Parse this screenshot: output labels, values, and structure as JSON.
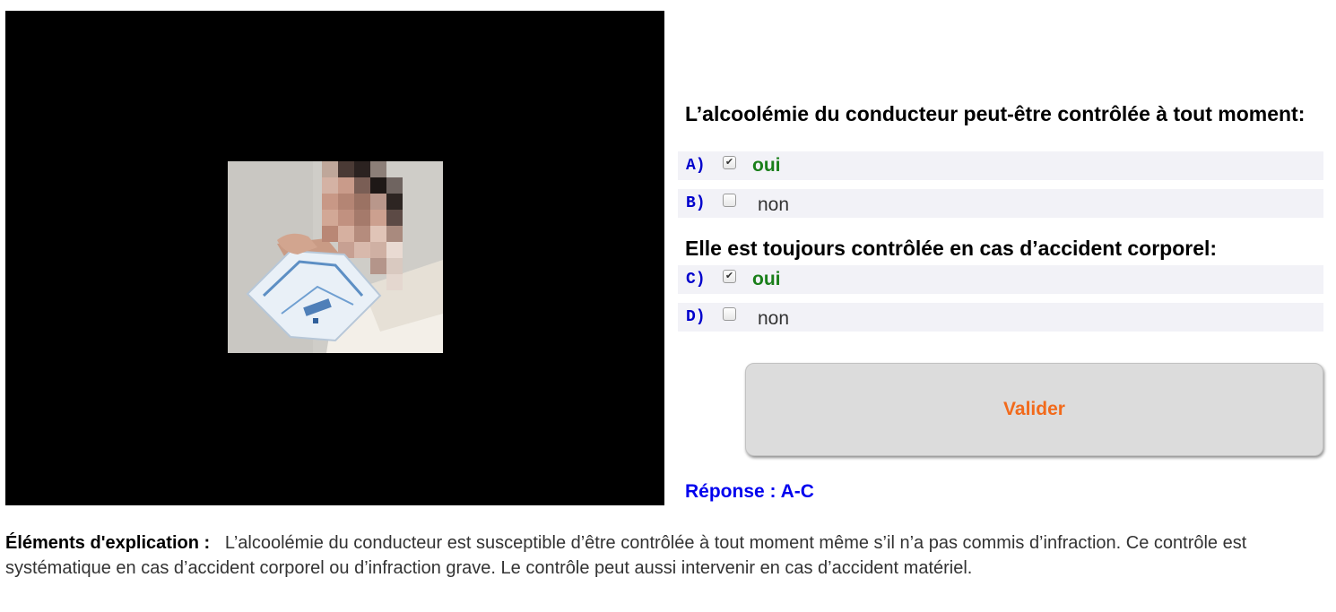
{
  "questions": [
    {
      "text": "L’alcoolémie du conducteur peut-être contrôlée à tout moment:",
      "options": [
        {
          "letter": "A)",
          "label": "oui",
          "checked": true,
          "correct": true
        },
        {
          "letter": "B)",
          "label": "non",
          "checked": false,
          "correct": false
        }
      ]
    },
    {
      "text": "Elle est toujours contrôlée en cas d’accident corporel:",
      "options": [
        {
          "letter": "C)",
          "label": "oui",
          "checked": true,
          "correct": true
        },
        {
          "letter": "D)",
          "label": "non",
          "checked": false,
          "correct": false
        }
      ]
    }
  ],
  "validate_label": "Valider",
  "answer_text": "Réponse : A-C",
  "explanation": {
    "title": "Éléments d'explication :",
    "text": "L’alcoolémie du conducteur est susceptible d’être contrôlée à tout moment même s’il n’a pas commis d’infraction. Ce contrôle est systématique en cas d’accident corporel ou d’infraction grave. Le contrôle peut aussi intervenir en cas d’accident matériel."
  },
  "colors": {
    "correct": "#1a7f1a",
    "letter": "#0000cc",
    "validate_text": "#f26a1b",
    "answer": "#0000ee"
  }
}
